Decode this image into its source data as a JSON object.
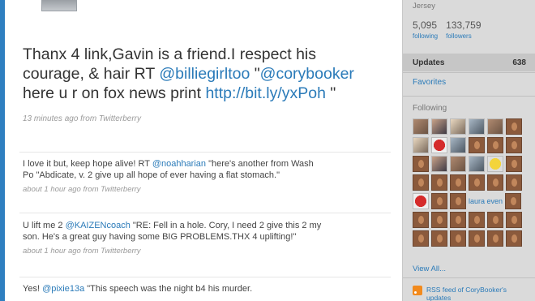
{
  "main_tweet": {
    "text_before": "Thanx 4 link,Gavin is a friend.I respect his courage, & hair RT ",
    "mention1": "@billiegirltoo",
    "text_mid": " \"",
    "mention2": "@corybooker",
    "text_after": " here u r on fox news print ",
    "link": "http://bit.ly/yxPoh",
    "text_end": " \"",
    "meta": "13 minutes ago from Twitterberry"
  },
  "tweets": [
    {
      "text_before": "I love it but, keep hope alive! RT ",
      "mention": "@noahharian",
      "text_after": " \"here's another from Wash Po \"Abdicate, v. 2 give up all hope of ever having a flat stomach.\"",
      "meta": "about 1 hour ago from Twitterberry"
    },
    {
      "text_before": "U lift me 2 ",
      "mention": "@KAIZENcoach",
      "text_after": " \"RE: Fell in a hole. Cory, I need 2 give this 2 my son. He's a great guy having some BIG PROBLEMS.THX 4 uplifting!\"",
      "meta": "about 1 hour ago from Twitterberry"
    },
    {
      "text_before": "Yes! ",
      "mention": "@pixie13a",
      "text_after": " \"This speech was the night b4 his murder.",
      "meta": ""
    }
  ],
  "sidebar": {
    "location": "Jersey",
    "following_count": "5,095",
    "following_label": "following",
    "followers_count": "133,759",
    "followers_label": "followers",
    "updates_label": "Updates",
    "updates_count": "638",
    "favorites_label": "Favorites",
    "following_title": "Following",
    "grid_name": "laura even",
    "view_all": "View All...",
    "rss_label": "RSS feed of CoryBooker's updates"
  }
}
